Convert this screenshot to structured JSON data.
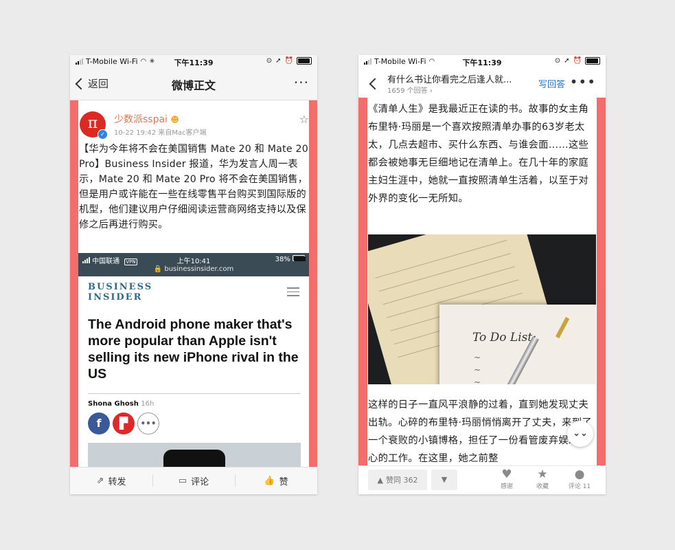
{
  "left_phone": {
    "status": {
      "carrier": "T-Mobile Wi-Fi",
      "time": "下午11:39"
    },
    "nav": {
      "back_label": "返回",
      "title": "微博正文",
      "more": "···"
    },
    "post": {
      "author": "少数派sspai",
      "avatar_text": "π",
      "meta": "10-22 19:42  来自Mac客户端",
      "text": "【华为今年将不会在美国销售 Mate 20 和 Mate 20 Pro】Business Insider 报道，华为发言人周一表示，Mate 20 和 Mate 20 Pro 将不会在美国销售，但是用户或许能在一些在线零售平台购买到国际版的机型，他们建议用户仔细阅读运营商网络支持以及保修之后再进行购买。"
    },
    "embedded": {
      "carrier": "中国联通",
      "vpn": "VPN",
      "time": "上午10:41",
      "battery": "38%",
      "url": "🔒 businessinsider.com",
      "logo_line1": "BUSINESS",
      "logo_line2": "INSIDER",
      "headline": "The Android phone maker that's more popular than Apple isn't selling its new iPhone rival in the US",
      "author": "Shona Ghosh",
      "age": "16h",
      "share_fb": "f",
      "share_more": "•••"
    },
    "bottom": {
      "repost": "转发",
      "comment": "评论",
      "like": "赞"
    }
  },
  "right_phone": {
    "status": {
      "carrier": "T-Mobile Wi-Fi",
      "time": "下午11:39"
    },
    "nav": {
      "question": "有什么书让你看完之后逢人就...",
      "answers": "1659 个回答 ›",
      "write": "写回答",
      "more": "•••"
    },
    "answer": {
      "p1": "《清单人生》是我最近正在读的书。故事的女主角布里特·玛丽是一个喜欢按照清单办事的63岁老太太，几点去超市、买什么东西、与谁会面……这些都会被她事无巨细地记在清单上。在几十年的家庭主妇生涯中，她就一直按照清单生活着，以至于对外界的变化一无所知。",
      "image_text": "To Do List:",
      "p2": "这样的日子一直风平浪静的过着，直到她发现丈夫出轨。心碎的布里特·玛丽悄悄离开了丈夫，来到了一个衰败的小镇博格，担任了一份看管废弃娱乐中心的工作。在这里，她之前整"
    },
    "bottom": {
      "upvote": "赞同 362",
      "thanks": "感谢",
      "favorite": "收藏",
      "comments": "评论 11"
    }
  },
  "colors": {
    "highlight": "#f36d6a",
    "weibo_orange": "#eb7350",
    "zhihu_blue": "#1e73d6"
  }
}
